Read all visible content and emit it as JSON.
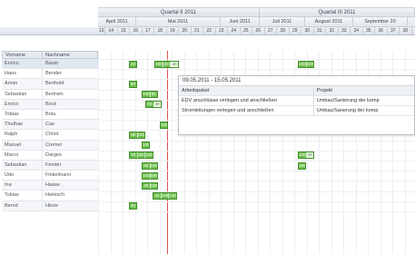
{
  "timeline": {
    "quarters": [
      {
        "label": "Quartal II 2011"
      },
      {
        "label": "Quartal III 2011"
      }
    ],
    "months": [
      "April 2011",
      "Mai 2011",
      "Juni 2011",
      "Juli 2011",
      "August 2011",
      "September 20"
    ],
    "weeks": [
      "13",
      "14",
      "15",
      "16",
      "17",
      "18",
      "19",
      "20",
      "21",
      "22",
      "23",
      "24",
      "25",
      "26",
      "27",
      "28",
      "29",
      "30",
      "31",
      "32",
      "33",
      "34",
      "35",
      "36",
      "37",
      "38"
    ]
  },
  "grid": {
    "col_first": "Vorname",
    "col_last": "Nachname",
    "rows": [
      {
        "first": "Enrico",
        "last": "Baum"
      },
      {
        "first": "Hans",
        "last": "Bender"
      },
      {
        "first": "Armin",
        "last": "Berthold"
      },
      {
        "first": "Sebastian",
        "last": "Bertram"
      },
      {
        "first": "Enrico",
        "last": "Bock"
      },
      {
        "first": "Tobias",
        "last": "Bräu"
      },
      {
        "first": "Thuthao",
        "last": "Cao"
      },
      {
        "first": "Ralph",
        "last": "Christ"
      },
      {
        "first": "Manuel",
        "last": "Cremer"
      },
      {
        "first": "Marco",
        "last": "Darges"
      },
      {
        "first": "Sebastian",
        "last": "Fender"
      },
      {
        "first": "Udo",
        "last": "Finkelmann"
      },
      {
        "first": "Ina",
        "last": "Haase"
      },
      {
        "first": "Tobias",
        "last": "Heinisch"
      },
      {
        "first": "Bernd",
        "last": "Hinze"
      }
    ]
  },
  "popup": {
    "date_range": "09.05.2011 - 15.05.2011",
    "col_package": "Arbeitspaket",
    "col_project": "Projekt",
    "rows": [
      {
        "package": "EDV anschlüsse verlegen und anschließen",
        "project": "Umbau/Sanierung der komp"
      },
      {
        "package": "Stromleitungen verlegen und anschließen",
        "project": "Umbau/Sanerung der komp"
      }
    ]
  },
  "bars": [
    {
      "row": 0,
      "segs": [
        "40"
      ]
    },
    {
      "row": 0,
      "segs": [
        "100",
        "80",
        "40"
      ]
    },
    {
      "row": 0,
      "segs": [
        "100",
        "100"
      ]
    },
    {
      "row": 2,
      "segs": [
        "80"
      ]
    },
    {
      "row": 3,
      "segs": [
        "100",
        "80"
      ]
    },
    {
      "row": 4,
      "segs": [
        "80",
        "40"
      ]
    },
    {
      "row": 5,
      "segs": [
        "20"
      ]
    },
    {
      "row": 6,
      "segs": [
        "100"
      ]
    },
    {
      "row": 6,
      "segs": [
        "40"
      ]
    },
    {
      "row": 7,
      "segs": [
        "80",
        "100"
      ]
    },
    {
      "row": 8,
      "segs": [
        "100"
      ]
    },
    {
      "row": 9,
      "segs": [
        "20",
        "80",
        "100"
      ]
    },
    {
      "row": 9,
      "segs": [
        "100",
        "40"
      ]
    },
    {
      "row": 10,
      "segs": [
        "80",
        "100"
      ]
    },
    {
      "row": 10,
      "segs": [
        "100"
      ]
    },
    {
      "row": 11,
      "segs": [
        "100",
        "100"
      ]
    },
    {
      "row": 12,
      "segs": [
        "40",
        "100"
      ]
    },
    {
      "row": 13,
      "segs": [
        "20",
        "100",
        "100"
      ]
    },
    {
      "row": 14,
      "segs": [
        "40"
      ]
    }
  ],
  "colors": {
    "bar": "#6fbf4f",
    "bar_border": "#3f8f2a",
    "today_line": "#e05050"
  }
}
